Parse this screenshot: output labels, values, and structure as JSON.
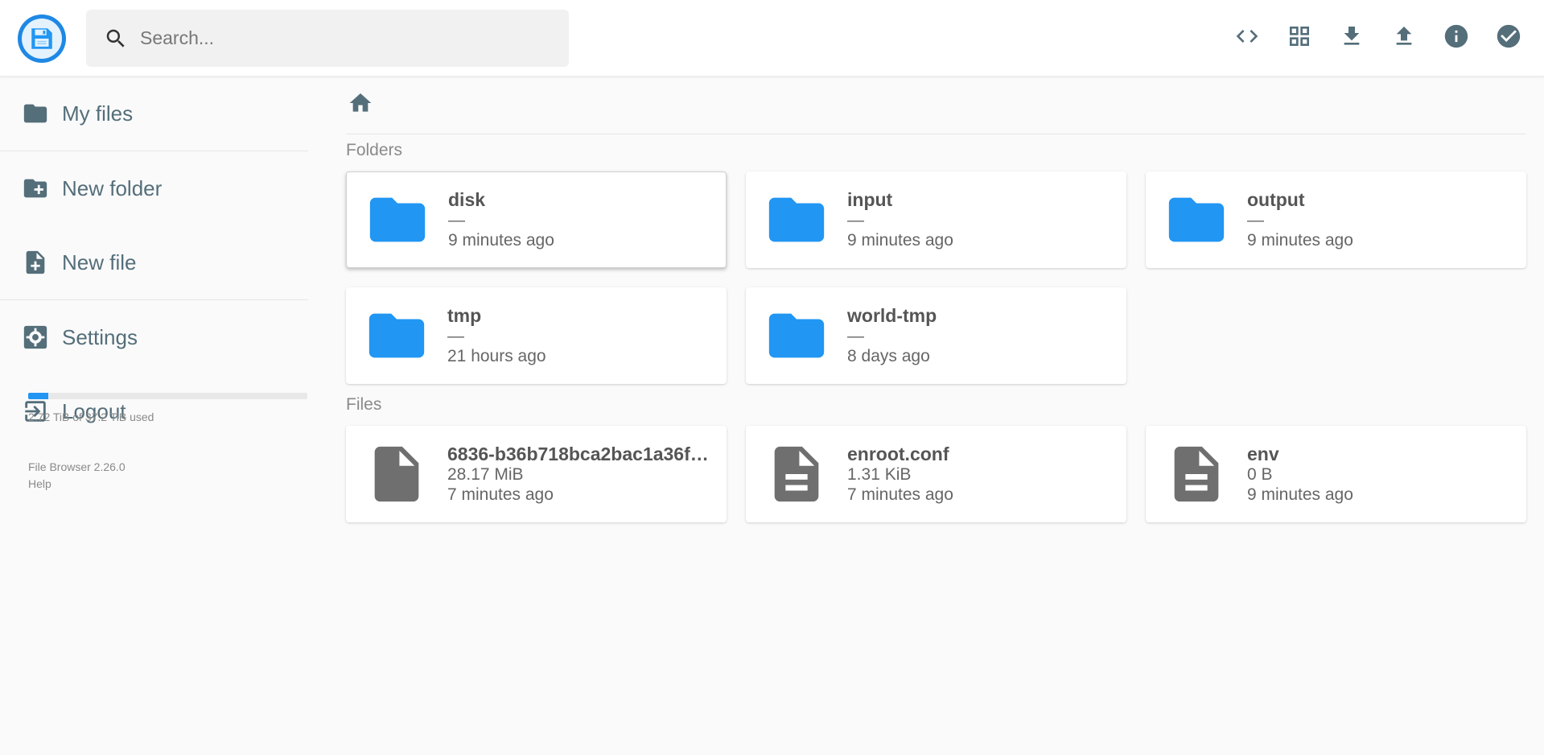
{
  "header": {
    "search_placeholder": "Search...",
    "actions": [
      {
        "name": "code-view-icon"
      },
      {
        "name": "grid-view-icon"
      },
      {
        "name": "download-icon"
      },
      {
        "name": "upload-icon"
      },
      {
        "name": "info-icon"
      },
      {
        "name": "select-multiple-icon"
      }
    ]
  },
  "sidebar": {
    "items": [
      {
        "label": "My files",
        "icon": "folder-icon"
      },
      {
        "label": "New folder",
        "icon": "create-new-folder-icon"
      },
      {
        "label": "New file",
        "icon": "note-add-icon"
      },
      {
        "label": "Settings",
        "icon": "settings-icon"
      },
      {
        "label": "Logout",
        "icon": "exit-icon"
      }
    ],
    "usage": {
      "text": "2.72 TiB of 37.2 TiB used",
      "fraction": 0.073
    },
    "credits": {
      "version": "File Browser 2.26.0",
      "help": "Help"
    }
  },
  "main": {
    "folders_title": "Folders",
    "files_title": "Files",
    "folders": [
      {
        "name": "disk",
        "size": "—",
        "modified": "9 minutes ago"
      },
      {
        "name": "input",
        "size": "—",
        "modified": "9 minutes ago"
      },
      {
        "name": "output",
        "size": "—",
        "modified": "9 minutes ago"
      },
      {
        "name": "tmp",
        "size": "—",
        "modified": "21 hours ago"
      },
      {
        "name": "world-tmp",
        "size": "—",
        "modified": "8 days ago"
      }
    ],
    "files": [
      {
        "name": "6836-b36b718bca2bac1a36f…",
        "size": "28.17 MiB",
        "modified": "7 minutes ago",
        "type": "blank"
      },
      {
        "name": "enroot.conf",
        "size": "1.31 KiB",
        "modified": "7 minutes ago",
        "type": "text"
      },
      {
        "name": "env",
        "size": "0 B",
        "modified": "9 minutes ago",
        "type": "text"
      }
    ]
  },
  "colors": {
    "accent": "#2196f3",
    "folder": "#2196f3",
    "file": "#6f6f6f",
    "nav": "#546e7a"
  }
}
